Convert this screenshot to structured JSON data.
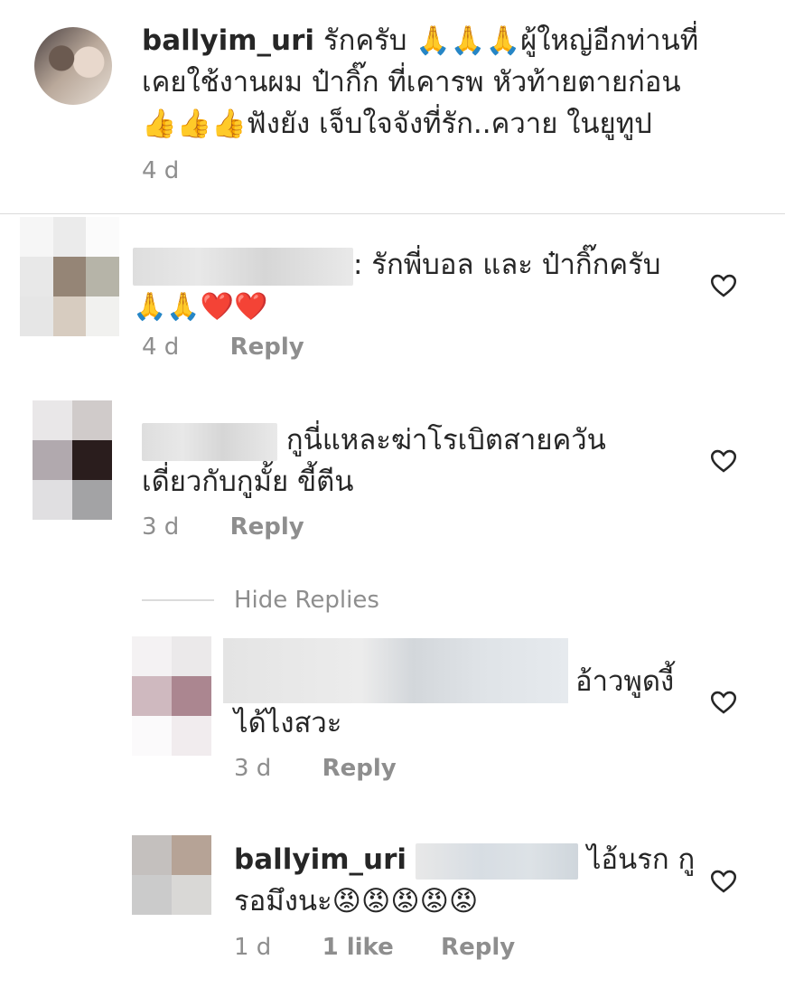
{
  "comments": [
    {
      "username": "ballyim_uri",
      "text_line1": "รักครับ 🙏🙏🙏ผู้ใหญ่อีกท่านที่",
      "text_line2": "เคยใช้งานผม ป๋ากิ๊ก ที่เคารพ หัวท้ายตายก่อน",
      "text_line3": "👍👍👍ฟังยัง เจ็บใจจังที่รัก..ควาย ในยูทูป",
      "time": "4 d"
    },
    {
      "text_line1": ": รักพี่บอล และ ป๋ากิ๊กครับ",
      "text_line2": "🙏🙏❤️❤️",
      "time": "4 d",
      "reply": "Reply"
    },
    {
      "text_line1": "กูนี่แหละฆ่าโรเบิตสายควัน",
      "text_line2": "เดี่ยวกับกูมั้ย ขี้ตีน",
      "time": "3 d",
      "reply": "Reply"
    }
  ],
  "hide_replies": "Hide Replies",
  "replies": [
    {
      "text_line1": "อ้าวพูดงี้",
      "text_line2": "ได้ไงสวะ",
      "time": "3 d",
      "reply": "Reply"
    },
    {
      "username": "ballyim_uri",
      "text_line1": "ไอ้นรก กู",
      "text_line2": "รอมึงนะ😡😡😡😡😡",
      "time": "1 d",
      "likes": "1 like",
      "reply": "Reply"
    }
  ],
  "icons": {
    "heart": "heart-outline-icon"
  },
  "colors": {
    "text": "#262626",
    "meta": "#8e8e8e",
    "divider": "#dbdbdb"
  }
}
